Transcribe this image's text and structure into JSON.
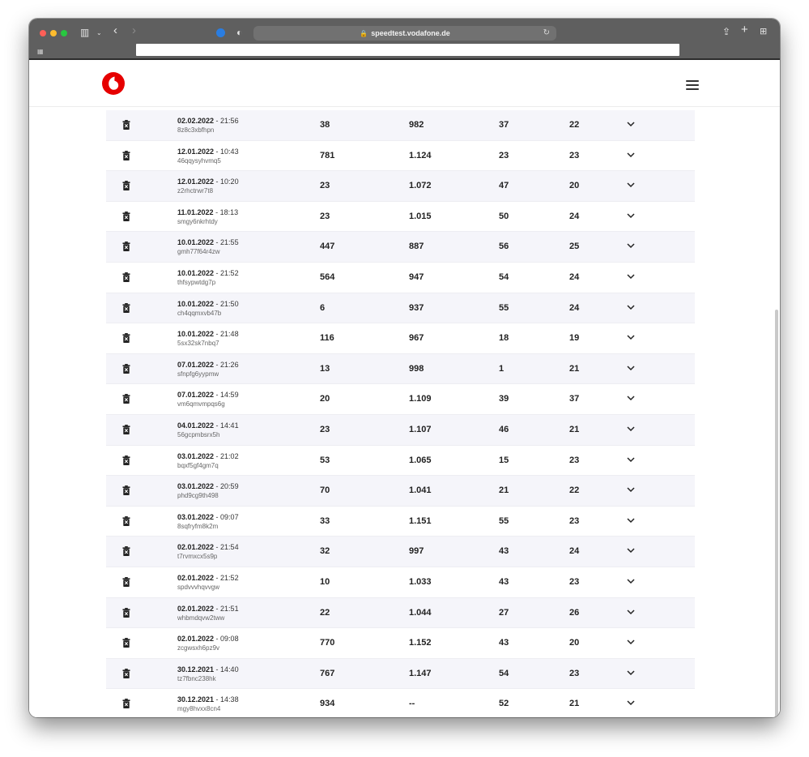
{
  "browser": {
    "url": "speedtest.vodafone.de"
  },
  "brand": {
    "accent": "#e60000"
  },
  "rows": [
    {
      "date": "02.02.2022",
      "time": "21:56",
      "id": "8z8c3xbfhpn",
      "ping": "38",
      "download": "982",
      "upload": "37",
      "jitter": "22"
    },
    {
      "date": "12.01.2022",
      "time": "10:43",
      "id": "46qqysyhvmq5",
      "ping": "781",
      "download": "1.124",
      "upload": "23",
      "jitter": "23"
    },
    {
      "date": "12.01.2022",
      "time": "10:20",
      "id": "z2rhctrwr7t8",
      "ping": "23",
      "download": "1.072",
      "upload": "47",
      "jitter": "20"
    },
    {
      "date": "11.01.2022",
      "time": "18:13",
      "id": "smgy6nkrhtdy",
      "ping": "23",
      "download": "1.015",
      "upload": "50",
      "jitter": "24"
    },
    {
      "date": "10.01.2022",
      "time": "21:55",
      "id": "gmh77f64r4zw",
      "ping": "447",
      "download": "887",
      "upload": "56",
      "jitter": "25"
    },
    {
      "date": "10.01.2022",
      "time": "21:52",
      "id": "thfsypwtdg7p",
      "ping": "564",
      "download": "947",
      "upload": "54",
      "jitter": "24"
    },
    {
      "date": "10.01.2022",
      "time": "21:50",
      "id": "ch4qqmxvb47b",
      "ping": "6",
      "download": "937",
      "upload": "55",
      "jitter": "24"
    },
    {
      "date": "10.01.2022",
      "time": "21:48",
      "id": "5sx32sk7nbq7",
      "ping": "116",
      "download": "967",
      "upload": "18",
      "jitter": "19"
    },
    {
      "date": "07.01.2022",
      "time": "21:26",
      "id": "sfnpfg6yypmw",
      "ping": "13",
      "download": "998",
      "upload": "1",
      "jitter": "21"
    },
    {
      "date": "07.01.2022",
      "time": "14:59",
      "id": "vm6qmvmpqs6g",
      "ping": "20",
      "download": "1.109",
      "upload": "39",
      "jitter": "37"
    },
    {
      "date": "04.01.2022",
      "time": "14:41",
      "id": "56gcpmbsrx5h",
      "ping": "23",
      "download": "1.107",
      "upload": "46",
      "jitter": "21"
    },
    {
      "date": "03.01.2022",
      "time": "21:02",
      "id": "bqxf5gf4gm7q",
      "ping": "53",
      "download": "1.065",
      "upload": "15",
      "jitter": "23"
    },
    {
      "date": "03.01.2022",
      "time": "20:59",
      "id": "phd9cg9th498",
      "ping": "70",
      "download": "1.041",
      "upload": "21",
      "jitter": "22"
    },
    {
      "date": "03.01.2022",
      "time": "09:07",
      "id": "8sqfryfm8k2m",
      "ping": "33",
      "download": "1.151",
      "upload": "55",
      "jitter": "23"
    },
    {
      "date": "02.01.2022",
      "time": "21:54",
      "id": "t7rvmxcx5s9p",
      "ping": "32",
      "download": "997",
      "upload": "43",
      "jitter": "24"
    },
    {
      "date": "02.01.2022",
      "time": "21:52",
      "id": "spdvvvhqvvgw",
      "ping": "10",
      "download": "1.033",
      "upload": "43",
      "jitter": "23"
    },
    {
      "date": "02.01.2022",
      "time": "21:51",
      "id": "whbmdqvw2tww",
      "ping": "22",
      "download": "1.044",
      "upload": "27",
      "jitter": "26"
    },
    {
      "date": "02.01.2022",
      "time": "09:08",
      "id": "zcgwsxh6pz9v",
      "ping": "770",
      "download": "1.152",
      "upload": "43",
      "jitter": "20"
    },
    {
      "date": "30.12.2021",
      "time": "14:40",
      "id": "tz7fbnc238hk",
      "ping": "767",
      "download": "1.147",
      "upload": "54",
      "jitter": "23"
    },
    {
      "date": "30.12.2021",
      "time": "14:38",
      "id": "mgy8hvxx8cn4",
      "ping": "934",
      "download": "--",
      "upload": "52",
      "jitter": "21"
    }
  ]
}
